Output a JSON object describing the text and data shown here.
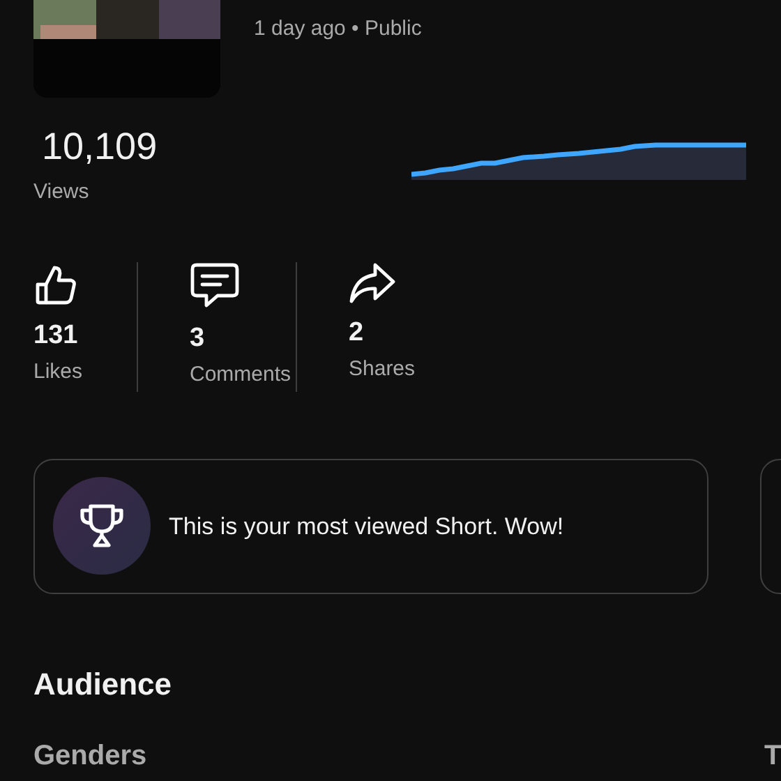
{
  "video": {
    "meta": "1 day ago • Public"
  },
  "views": {
    "value": "10,109",
    "label": "Views"
  },
  "stats": [
    {
      "kind": "likes",
      "value": "131",
      "label": "Likes"
    },
    {
      "kind": "comments",
      "value": "3",
      "label": "Comments"
    },
    {
      "kind": "shares",
      "value": "2",
      "label": "Shares"
    }
  ],
  "highlights": [
    {
      "kind": "trophy",
      "text": "This is your most viewed Short. Wow!"
    }
  ],
  "audience": {
    "title": "Audience",
    "sections": [
      "Genders",
      "T"
    ]
  }
}
